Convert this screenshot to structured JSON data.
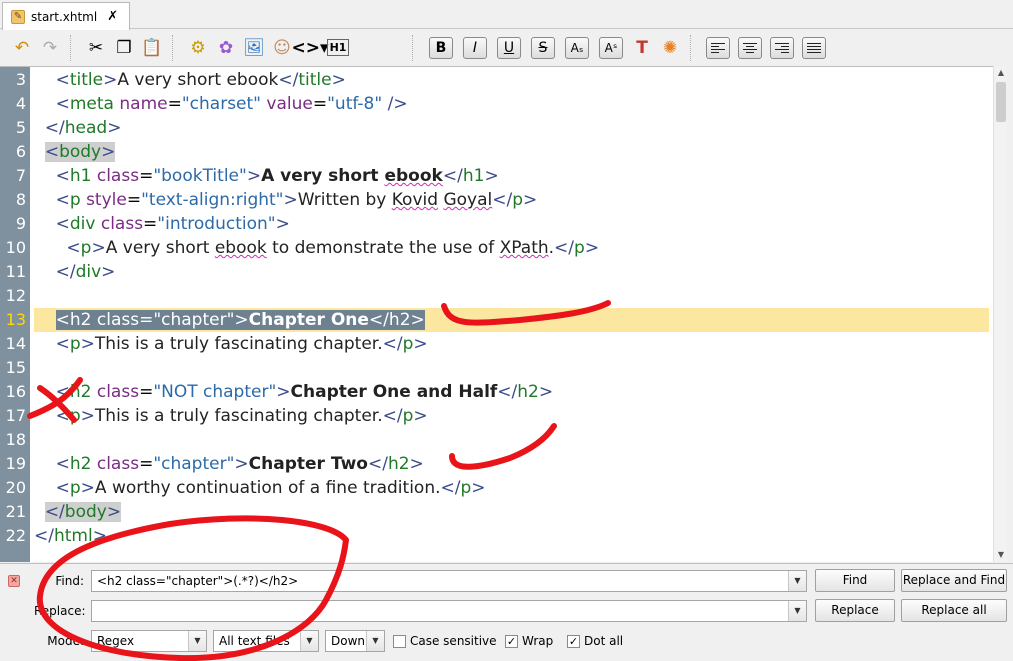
{
  "tab": {
    "label": "start.xhtml"
  },
  "toolbar": {
    "heading_label": "H1",
    "format_buttons": [
      "B",
      "I",
      "U",
      "S"
    ]
  },
  "editor": {
    "line_numbers": [
      "3",
      "4",
      "5",
      "6",
      "7",
      "8",
      "9",
      "10",
      "11",
      "12",
      "13",
      "14",
      "15",
      "16",
      "17",
      "18",
      "19",
      "20",
      "21",
      "22"
    ],
    "current_line": "13"
  },
  "find_panel": {
    "find_label": "Find:",
    "find_value": "<h2 class=\"chapter\">(.*?)</h2>",
    "replace_label": "Replace:",
    "replace_value": "",
    "mode_label": "Mode:",
    "mode_value": "Regex",
    "scope_value": "All text files",
    "direction_value": "Down",
    "case_sensitive_label": "Case sensitive",
    "case_sensitive_checked": false,
    "wrap_label": "Wrap",
    "wrap_checked": true,
    "dot_all_label": "Dot all",
    "dot_all_checked": true,
    "find_button": "Find",
    "replace_and_find_button": "Replace and Find",
    "replace_button": "Replace",
    "replace_all_button": "Replace all"
  },
  "colors": {
    "gutter": "#7f909e",
    "current_line": "#fce7a0",
    "selection": "#6e8190",
    "tag": "#1e7a27",
    "attribute": "#7a2c84",
    "value": "#2c6aa8",
    "annotation": "#e8141a"
  }
}
